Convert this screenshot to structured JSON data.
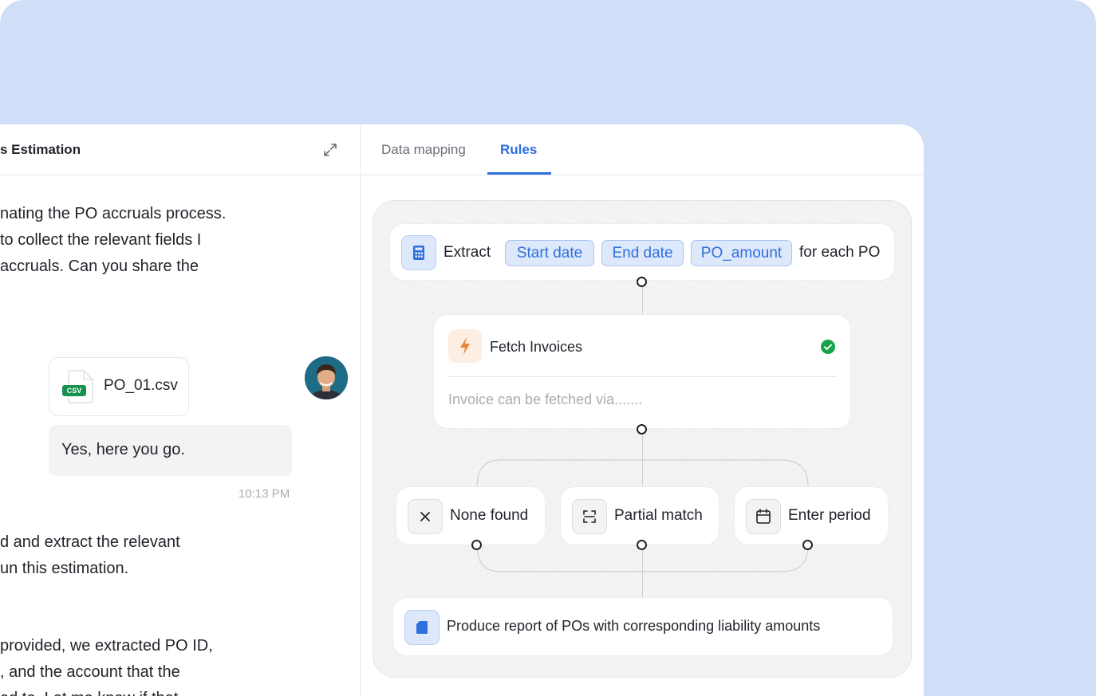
{
  "chat": {
    "title": "s Estimation",
    "messages": [
      {
        "lines": [
          "nating the PO accruals process.",
          "to collect the relevant fields I",
          "accruals. Can you share the"
        ]
      },
      {
        "lines": [
          "d and extract the relevant",
          "un this estimation."
        ]
      },
      {
        "lines": [
          "provided, we extracted PO ID,",
          ", and the account that the",
          "ed to. Let me know if that"
        ]
      }
    ],
    "attachment": {
      "file_name": "PO_01.csv",
      "badge": "CSV"
    },
    "user_reply": "Yes, here you go.",
    "timestamp": "10:13 PM"
  },
  "tabs": [
    {
      "label": "Data mapping",
      "active": false
    },
    {
      "label": "Rules",
      "active": true
    }
  ],
  "flow": {
    "extract": {
      "label": "Extract",
      "chips": [
        "Start date",
        "End date",
        "PO_amount"
      ],
      "suffix": "for each PO"
    },
    "fetch": {
      "title": "Fetch Invoices",
      "placeholder": "Invoice can be fetched via.......",
      "status": "complete"
    },
    "branches": [
      {
        "label": "None found",
        "icon": "close-icon"
      },
      {
        "label": "Partial match",
        "icon": "scan-icon"
      },
      {
        "label": "Enter period",
        "icon": "calendar-icon"
      }
    ],
    "report": {
      "label": "Produce report of POs with corresponding liability amounts"
    }
  },
  "colors": {
    "background": "#d1def8",
    "accent": "#2f6fde",
    "chip_bg": "#dde8fb",
    "success": "#17a34a",
    "fetch_icon_bg": "#fdeee3",
    "fetch_icon": "#e8843d"
  }
}
